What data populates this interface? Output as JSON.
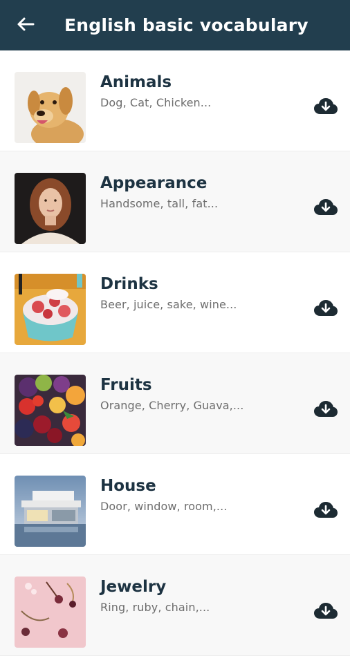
{
  "appbar": {
    "title": "English basic vocabulary",
    "back_icon": "arrow-left-icon",
    "background": "#223e4e"
  },
  "topics": [
    {
      "title": "Animals",
      "examples": "Dog, Cat, Chicken...",
      "image": "dog-photo"
    },
    {
      "title": "Appearance",
      "examples": "Handsome, tall, fat...",
      "image": "woman-portrait-photo"
    },
    {
      "title": "Drinks",
      "examples": "Beer, juice, sake, wine...",
      "image": "strawberry-dessert-photo"
    },
    {
      "title": "Fruits",
      "examples": "Orange, Cherry, Guava,...",
      "image": "mixed-fruits-photo"
    },
    {
      "title": "House",
      "examples": "Door, window, room,...",
      "image": "modern-house-photo"
    },
    {
      "title": "Jewelry",
      "examples": "Ring, ruby, chain,...",
      "image": "jewelry-photo"
    }
  ],
  "download_icon": "cloud-download-icon",
  "colors": {
    "title_text": "#1d3342",
    "subtitle_text": "#6d6d6d",
    "alt_row_bg": "#f8f8f8"
  }
}
